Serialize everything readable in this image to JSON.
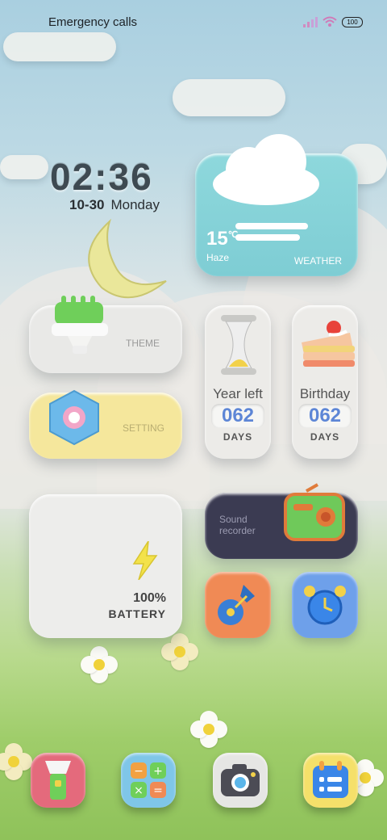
{
  "status_bar": {
    "carrier": "Emergency calls",
    "battery": "100",
    "icons": [
      "signal-icon",
      "wifi-icon",
      "battery-icon"
    ]
  },
  "clock": {
    "time": "02:36",
    "date": "10-30",
    "weekday": "Monday"
  },
  "weather": {
    "temp": "15",
    "unit": "℃",
    "condition": "Haze",
    "label": "WEATHER",
    "icon": "cloud-icon"
  },
  "widgets": {
    "theme_label": "THEME",
    "setting_label": "SETTING",
    "year_left": {
      "title": "Year left",
      "value": "062",
      "unit": "DAYS"
    },
    "birthday": {
      "title": "Birthday",
      "value": "062",
      "unit": "DAYS"
    },
    "battery": {
      "percent": "100%",
      "label": "BATTERY"
    },
    "recorder": {
      "label": "Sound recorder"
    }
  },
  "apps": [
    "guitar-app-icon",
    "alarm-clock-icon"
  ],
  "dock": [
    "flashlight-icon",
    "calculator-icon",
    "camera-icon",
    "calendar-icon"
  ],
  "colors": {
    "weather_bg": "#7ecdd4",
    "setting_bg": "#f5e79c",
    "recorder_bg": "#3b3b52",
    "count_value": "#5d86d6"
  }
}
